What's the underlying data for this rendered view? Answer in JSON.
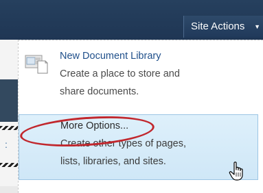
{
  "site_actions": {
    "label": "Site Actions",
    "caret": "▼"
  },
  "left_fragment": {
    "text": ":"
  },
  "menu": {
    "items": [
      {
        "title": "New Document Library",
        "desc_line1": "Create a place to store and",
        "desc_line2": "share documents."
      },
      {
        "title": "More Options...",
        "desc_line1": "Create other types of pages,",
        "desc_line2": "lists, libraries, and sites."
      }
    ]
  },
  "colors": {
    "topbar": "#1f3654",
    "menu_highlight": "#d6ecfa",
    "link_blue": "#1f4f8a",
    "annotation_red": "#c1272d"
  },
  "icons": [
    "document-library-icon",
    "hand-pointer-cursor-icon"
  ]
}
